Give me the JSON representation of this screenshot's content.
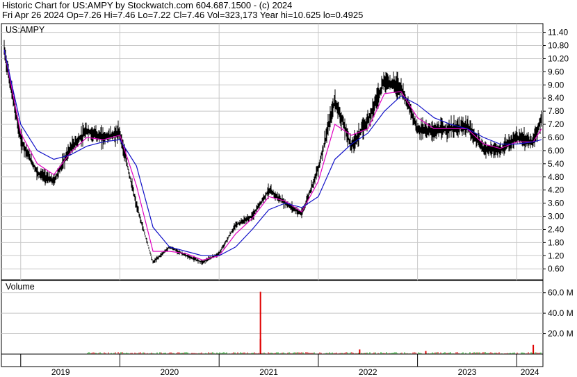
{
  "header": {
    "line1": "Historic Chart for US:AMPY by Stockwatch.com 604.687.1500 - (c) 2024",
    "line2": "Fri Apr 26 2024   Op=7.26  Hi=7.46  Lo=7.22  Cl=7.46  Vol=323,173  Year hi=10.625  lo=0.4925"
  },
  "chart_data": [
    {
      "type": "line",
      "title": "US:AMPY",
      "xlabel": "",
      "ylabel": "",
      "ylim": [
        0.1,
        11.8
      ],
      "ytick_labels": [
        "11.40",
        "10.80",
        "10.20",
        "9.60",
        "9.00",
        "8.40",
        "7.80",
        "7.20",
        "6.60",
        "6.00",
        "5.40",
        "4.80",
        "4.20",
        "3.60",
        "3.00",
        "2.40",
        "1.80",
        "1.20",
        "0.60"
      ],
      "x": [
        "2018-11",
        "2019-01",
        "2019-03",
        "2019-05",
        "2019-07",
        "2019-09",
        "2019-11",
        "2020-01",
        "2020-03",
        "2020-05",
        "2020-07",
        "2020-09",
        "2020-11",
        "2021-01",
        "2021-03",
        "2021-05",
        "2021-07",
        "2021-09",
        "2021-11",
        "2022-01",
        "2022-03",
        "2022-05",
        "2022-07",
        "2022-09",
        "2022-11",
        "2023-01",
        "2023-03",
        "2023-05",
        "2023-07",
        "2023-09",
        "2023-11",
        "2024-01",
        "2024-03",
        "2024-04"
      ],
      "series": [
        {
          "values": [
            10.6,
            6.5,
            5.0,
            4.6,
            6.1,
            6.9,
            6.6,
            6.8,
            3.5,
            0.9,
            1.6,
            1.2,
            0.9,
            1.3,
            2.6,
            3.0,
            4.2,
            3.6,
            3.1,
            5.2,
            8.3,
            6.2,
            7.4,
            9.2,
            8.9,
            7.0,
            6.9,
            7.0,
            7.1,
            6.1,
            6.0,
            6.6,
            6.4,
            7.46
          ]
        },
        {
          "values": [
            10.6,
            6.8,
            5.4,
            4.9,
            5.9,
            6.6,
            6.5,
            6.7,
            4.4,
            1.4,
            1.4,
            1.3,
            1.0,
            1.2,
            2.2,
            2.9,
            3.9,
            3.7,
            3.2,
            4.6,
            7.2,
            6.7,
            7.0,
            8.6,
            8.7,
            7.5,
            7.0,
            7.0,
            7.0,
            6.3,
            6.1,
            6.4,
            6.4,
            7.0
          ]
        },
        {
          "values": [
            10.6,
            7.2,
            6.0,
            5.6,
            5.8,
            6.2,
            6.4,
            6.5,
            5.3,
            2.5,
            1.6,
            1.4,
            1.2,
            1.2,
            1.6,
            2.4,
            3.3,
            3.6,
            3.4,
            3.9,
            5.6,
            6.3,
            6.8,
            7.8,
            8.5,
            8.1,
            7.5,
            7.2,
            7.0,
            6.6,
            6.3,
            6.3,
            6.4,
            6.5
          ]
        }
      ]
    },
    {
      "type": "bar",
      "title": "Volume",
      "ylim": [
        0,
        72
      ],
      "ytick_labels": [
        "60.0 M",
        "40.0 M",
        "20.0 M"
      ],
      "spikes": [
        {
          "x": "2021-06",
          "value": 61.0
        },
        {
          "x": "2021-06",
          "value": 15.0
        },
        {
          "x": "2024-03",
          "value": 9.0
        },
        {
          "x": "2022-06",
          "value": 4.5
        },
        {
          "x": "2023-02",
          "value": 3.0
        }
      ],
      "baseline_value": 1.2
    }
  ],
  "x_axis_years": [
    "2019",
    "2020",
    "2021",
    "2022",
    "2023",
    "2024"
  ],
  "colors": {
    "price": "#000000",
    "ma_fast": "#e000c0",
    "ma_slow": "#1010c8",
    "vol_red": "#e00000",
    "vol_green": "#00a000",
    "grid": "#c8c8c8"
  }
}
